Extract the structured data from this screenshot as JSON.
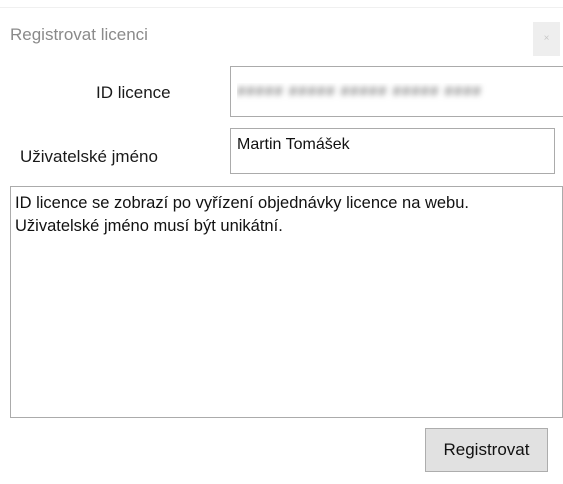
{
  "window": {
    "title": "Registrovat licenci",
    "close_label": "×"
  },
  "form": {
    "license_id_label": "ID licence",
    "license_id_value": "##### ##### ##### ##### ####",
    "username_label": "Uživatelské jméno",
    "username_value": "Martin Tomášek"
  },
  "info": {
    "line1": "ID licence se zobrazí po vyřízení objednávky licence na webu.",
    "line2": "Uživatelské jméno musí být unikátní."
  },
  "actions": {
    "register_label": "Registrovat"
  }
}
